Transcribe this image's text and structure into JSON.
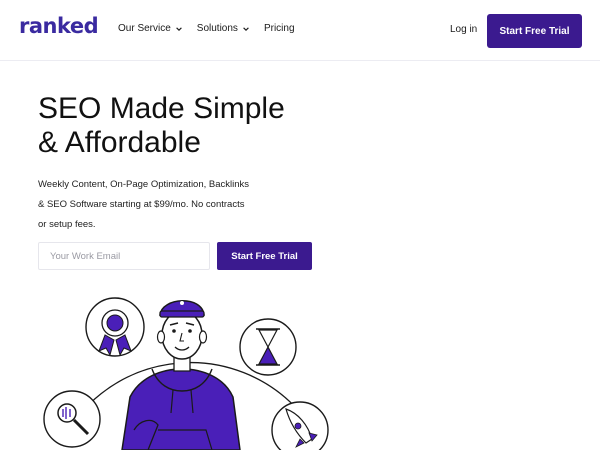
{
  "header": {
    "logo": "ranked",
    "nav": [
      {
        "label": "Our Service",
        "dropdown": true
      },
      {
        "label": "Solutions",
        "dropdown": true
      },
      {
        "label": "Pricing",
        "dropdown": false
      }
    ],
    "login_label": "Log in",
    "cta_label": "Start Free Trial"
  },
  "hero": {
    "title_line1": "SEO Made Simple",
    "title_line2": "& Affordable",
    "desc_line1": "Weekly Content, On-Page Optimization, Backlinks",
    "desc_line2": "& SEO Software starting at $99/mo. No contracts",
    "desc_line3": "or setup fees.",
    "email_placeholder": "Your Work Email",
    "cta_label": "Start Free Trial"
  },
  "illustration": {
    "icons": [
      "award-ribbon-icon",
      "hourglass-icon",
      "magnifier-icon",
      "rocket-icon"
    ]
  },
  "colors": {
    "brand": "#3b1a8f",
    "logo": "#3a2aa0",
    "accent_purple": "#4a1fb8"
  }
}
